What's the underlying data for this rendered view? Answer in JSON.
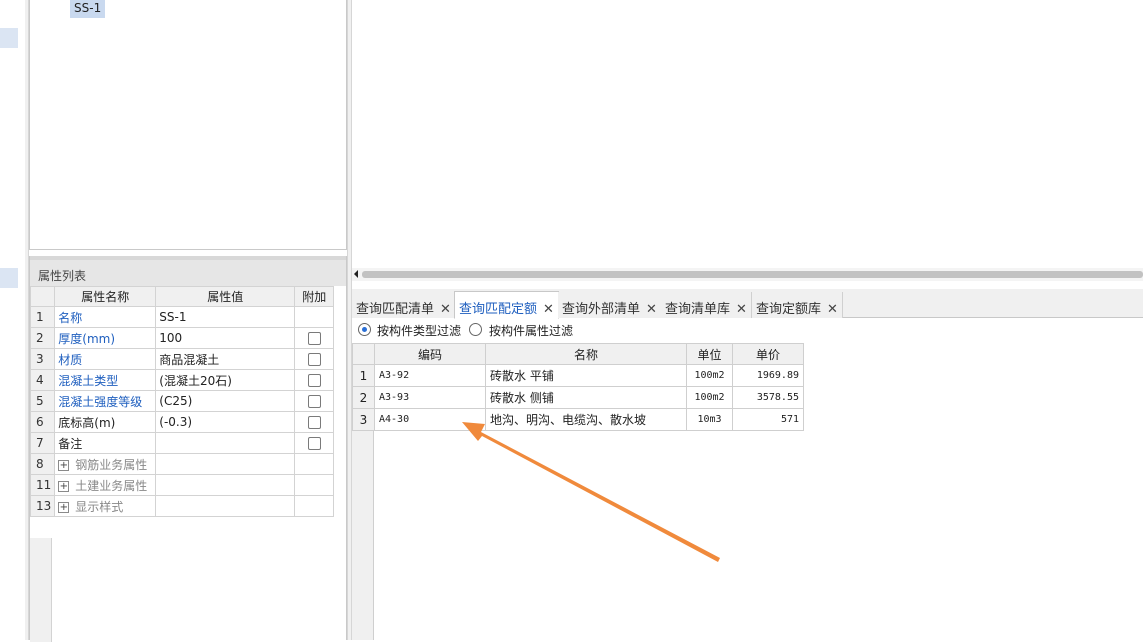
{
  "tree": {
    "selected_item": "SS-1"
  },
  "properties": {
    "title": "属性列表",
    "headers": {
      "name": "属性名称",
      "value": "属性值",
      "extra": "附加"
    },
    "rows": [
      {
        "num": "1",
        "name": "名称",
        "value": "SS-1",
        "style": "link",
        "check": false
      },
      {
        "num": "2",
        "name": "厚度(mm)",
        "value": "100",
        "style": "link",
        "check": true
      },
      {
        "num": "3",
        "name": "材质",
        "value": "商品混凝土",
        "style": "link",
        "check": true
      },
      {
        "num": "4",
        "name": "混凝土类型",
        "value": "(混凝土20石)",
        "style": "link",
        "check": true
      },
      {
        "num": "5",
        "name": "混凝土强度等级",
        "value": "(C25)",
        "style": "link",
        "check": true
      },
      {
        "num": "6",
        "name": "底标高(m)",
        "value": "(-0.3)",
        "style": "plain",
        "check": true
      },
      {
        "num": "7",
        "name": "备注",
        "value": "",
        "style": "plain",
        "check": true
      },
      {
        "num": "8",
        "name": "钢筋业务属性",
        "value": "",
        "style": "group",
        "check": false
      },
      {
        "num": "11",
        "name": "土建业务属性",
        "value": "",
        "style": "group",
        "check": false
      },
      {
        "num": "13",
        "name": "显示样式",
        "value": "",
        "style": "group",
        "check": false
      }
    ]
  },
  "tabs": [
    {
      "label": "查询匹配清单",
      "active": false
    },
    {
      "label": "查询匹配定额",
      "active": true
    },
    {
      "label": "查询外部清单",
      "active": false
    },
    {
      "label": "查询清单库",
      "active": false
    },
    {
      "label": "查询定额库",
      "active": false
    }
  ],
  "filters": {
    "by_type": "按构件类型过滤",
    "by_attr": "按构件属性过滤",
    "selected": "by_type"
  },
  "quota_table": {
    "headers": {
      "code": "编码",
      "name": "名称",
      "unit": "单位",
      "price": "单价"
    },
    "rows": [
      {
        "num": "1",
        "code": "A3-92",
        "name": "砖散水 平铺",
        "unit": "100m2",
        "price": "1969.89"
      },
      {
        "num": "2",
        "code": "A3-93",
        "name": "砖散水 侧铺",
        "unit": "100m2",
        "price": "3578.55"
      },
      {
        "num": "3",
        "code": "A4-30",
        "name": "地沟、明沟、电缆沟、散水坡",
        "unit": "10m3",
        "price": "571"
      }
    ]
  },
  "annotation_arrow_color": "#f08a3c"
}
